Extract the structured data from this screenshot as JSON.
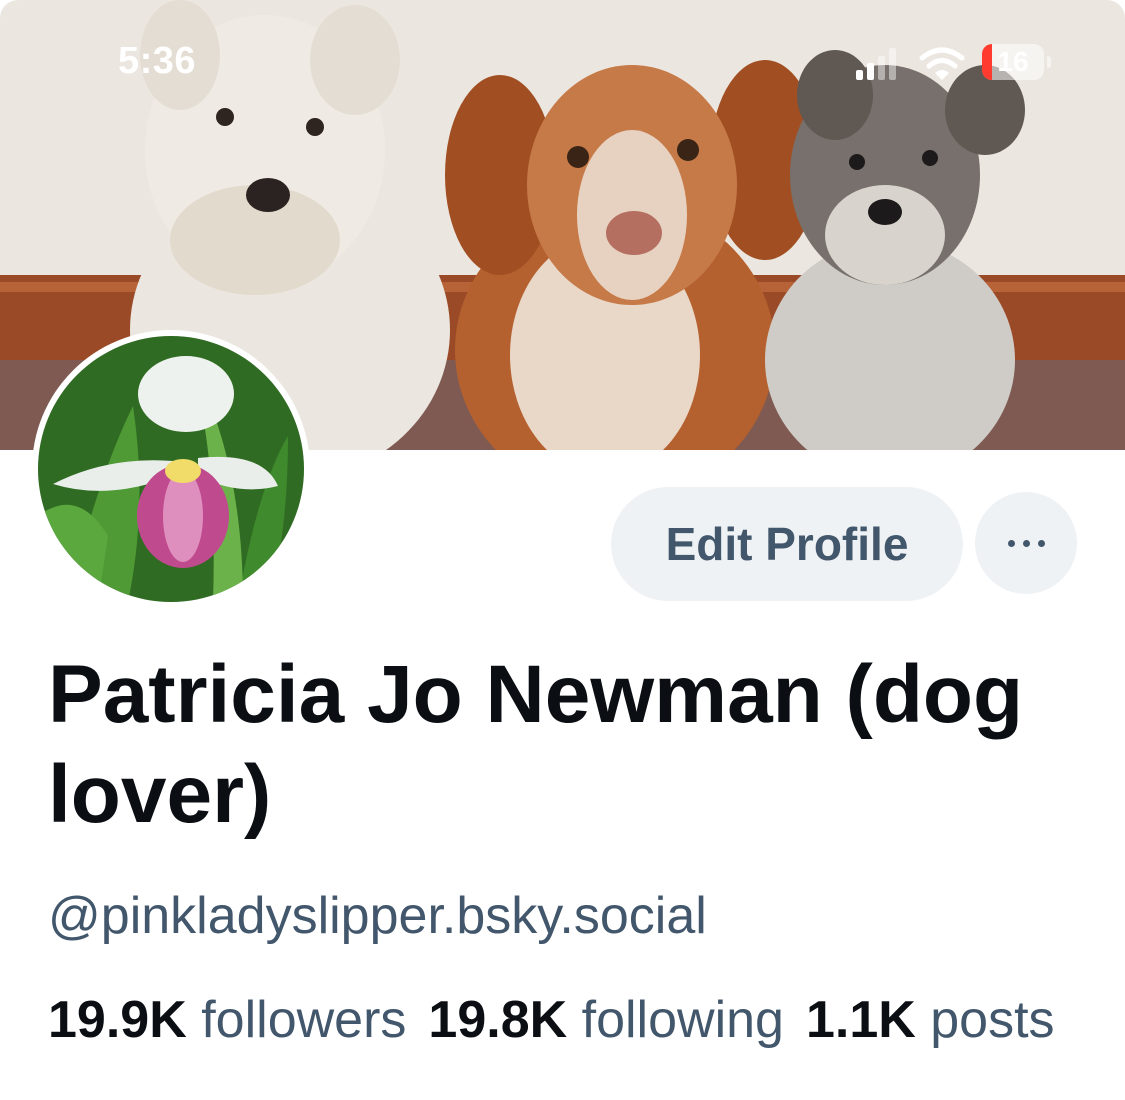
{
  "status_bar": {
    "time": "5:36",
    "battery_level": "16",
    "battery_fraction": 0.16
  },
  "icons": [
    "signal-icon",
    "wifi-icon",
    "battery-icon",
    "more-icon"
  ],
  "profile": {
    "display_name": "Patricia Jo Newman (dog lover)",
    "handle": "@pinkladyslipper.bsky.social",
    "edit_profile_label": "Edit Profile",
    "followers_count": "19.9K",
    "followers_label": "followers",
    "following_count": "19.8K",
    "following_label": "following",
    "posts_count": "1.1K",
    "posts_label": "posts"
  },
  "colors": {
    "name_text": "#0b0f14",
    "secondary_text": "#42576c",
    "button_bg": "#eff2f5",
    "battery_low": "#ff3b30"
  }
}
